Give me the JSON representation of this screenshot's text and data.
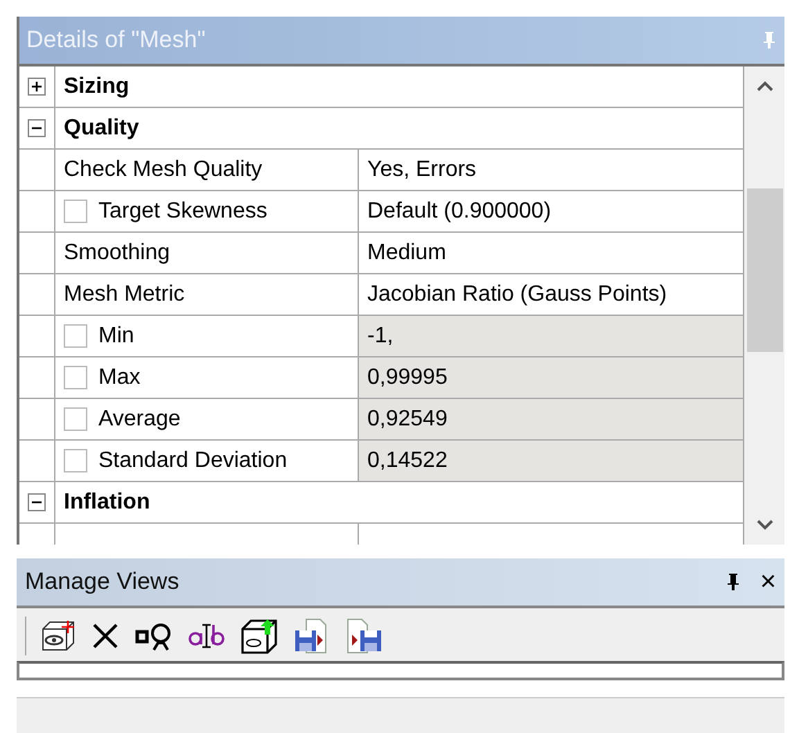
{
  "details_panel": {
    "title": "Details of \"Mesh\"",
    "sections": [
      {
        "title": "Sizing",
        "expanded": false
      },
      {
        "title": "Quality",
        "expanded": true,
        "rows": [
          {
            "kind": "plain",
            "label": "Check Mesh Quality",
            "value": "Yes, Errors",
            "readonly": false
          },
          {
            "kind": "check",
            "checked": false,
            "label": "Target Skewness",
            "value": "Default (0.900000)",
            "readonly": false
          },
          {
            "kind": "plain",
            "label": "Smoothing",
            "value": "Medium",
            "readonly": false
          },
          {
            "kind": "plain",
            "label": "Mesh Metric",
            "value": "Jacobian Ratio (Gauss Points)",
            "readonly": false
          },
          {
            "kind": "check",
            "checked": false,
            "label": "Min",
            "value": "-1,",
            "readonly": true
          },
          {
            "kind": "check",
            "checked": false,
            "label": "Max",
            "value": "0,99995",
            "readonly": true
          },
          {
            "kind": "check",
            "checked": false,
            "label": "Average",
            "value": "0,92549",
            "readonly": true
          },
          {
            "kind": "check",
            "checked": false,
            "label": "Standard Deviation",
            "value": "0,14522",
            "readonly": true
          }
        ]
      },
      {
        "title": "Inflation",
        "expanded": true
      }
    ]
  },
  "manage_views": {
    "title": "Manage Views",
    "close": "×"
  }
}
